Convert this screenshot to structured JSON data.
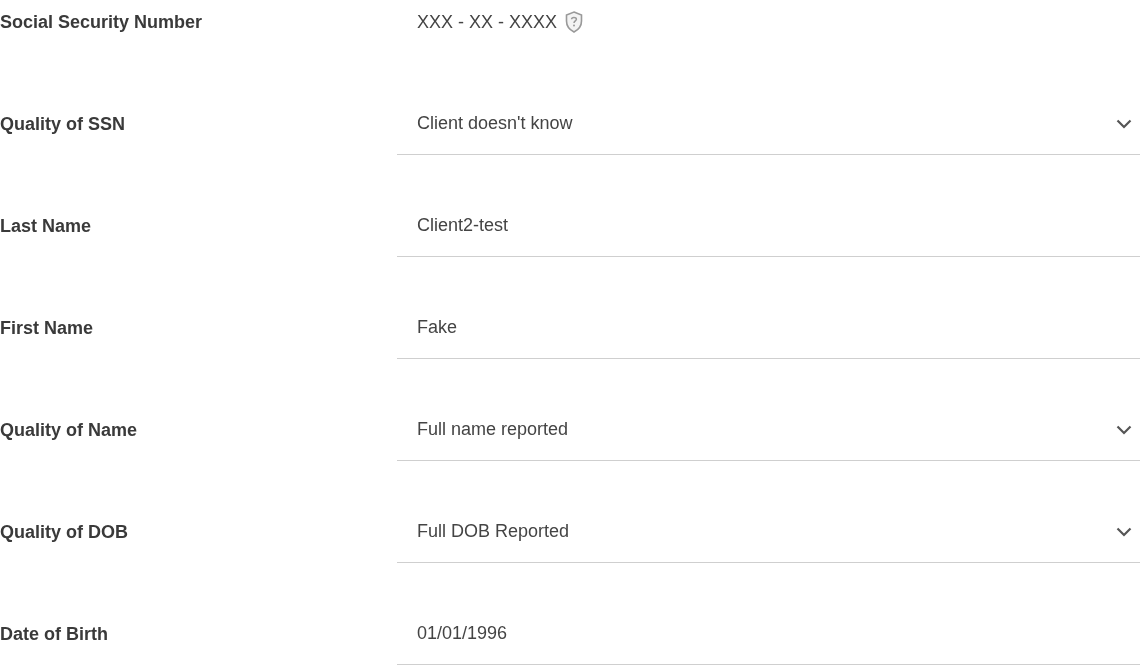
{
  "fields": [
    {
      "kind": "masked",
      "label": "Social Security Number",
      "value": "XXX - XX - XXXX"
    },
    {
      "kind": "select",
      "label": "Quality of SSN",
      "value": "Client doesn't know"
    },
    {
      "kind": "text",
      "label": "Last Name",
      "value": "Client2-test"
    },
    {
      "kind": "text",
      "label": "First Name",
      "value": "Fake"
    },
    {
      "kind": "select",
      "label": "Quality of Name",
      "value": "Full name reported"
    },
    {
      "kind": "select",
      "label": "Quality of DOB",
      "value": "Full DOB Reported"
    },
    {
      "kind": "text",
      "label": "Date of Birth",
      "value": "01/01/1996"
    }
  ]
}
